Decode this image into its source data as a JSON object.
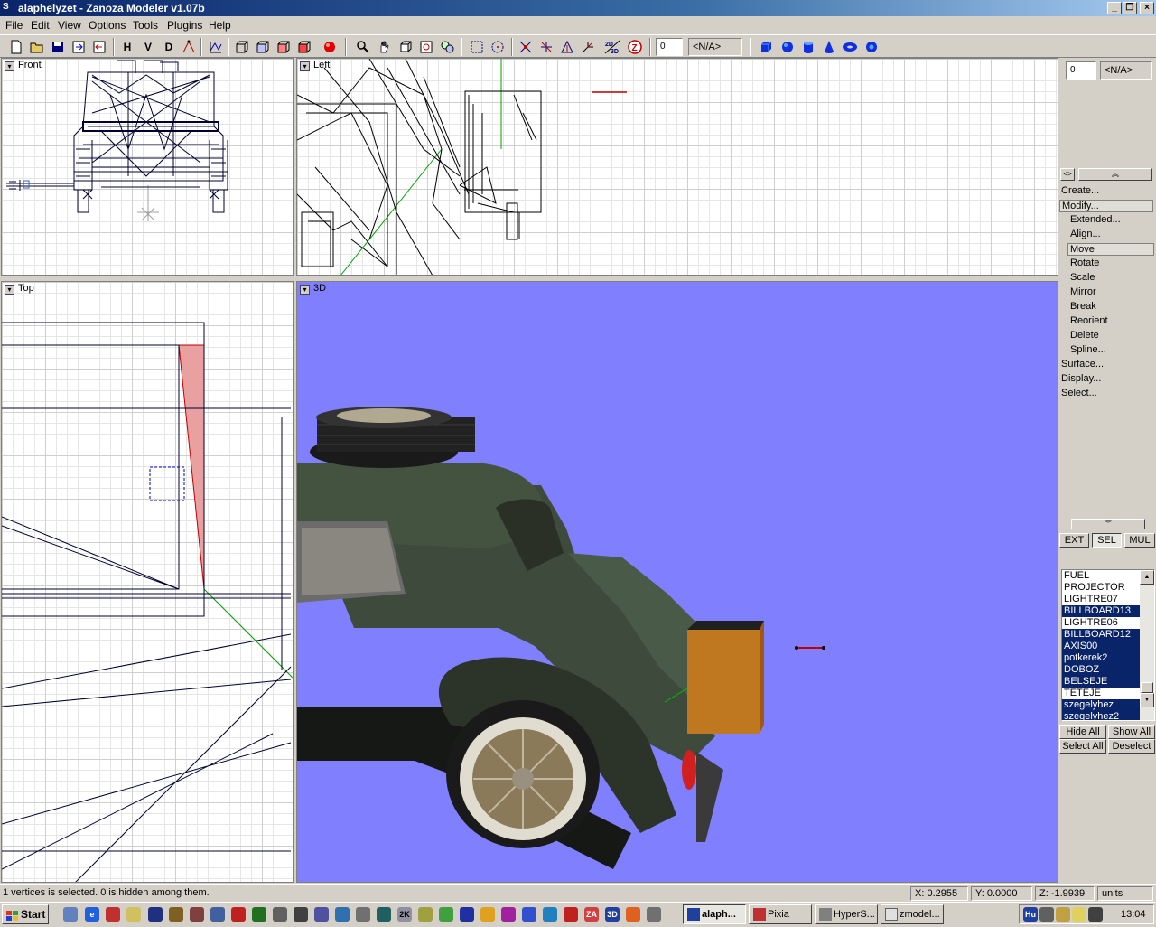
{
  "window": {
    "title": "alaphelyzet - Zanoza Modeler v1.07b"
  },
  "menu": [
    "File",
    "Edit",
    "View",
    "Options",
    "Tools",
    "Plugins",
    "Help"
  ],
  "toolbar": {
    "letters": [
      "H",
      "V",
      "D"
    ],
    "spin_value": "0",
    "na_value": "<N/A>"
  },
  "viewports": {
    "front": "Front",
    "left": "Left",
    "top": "Top",
    "threed": "3D"
  },
  "panel": {
    "spin_value": "0",
    "na_value": "<N/A>",
    "menu": [
      {
        "label": "Create...",
        "sub": false
      },
      {
        "label": "Modify...",
        "sub": false,
        "selected": true
      },
      {
        "label": "Extended...",
        "sub": true
      },
      {
        "label": "Align...",
        "sub": true
      },
      {
        "label": "Move",
        "sub": true,
        "selected": true
      },
      {
        "label": "Rotate",
        "sub": true
      },
      {
        "label": "Scale",
        "sub": true
      },
      {
        "label": "Mirror",
        "sub": true
      },
      {
        "label": "Break",
        "sub": true
      },
      {
        "label": "Reorient",
        "sub": true
      },
      {
        "label": "Delete",
        "sub": true
      },
      {
        "label": "Spline...",
        "sub": true
      },
      {
        "label": "Surface...",
        "sub": false
      },
      {
        "label": "Display...",
        "sub": false
      },
      {
        "label": "Select...",
        "sub": false
      }
    ],
    "mode_buttons": [
      "EXT",
      "SEL",
      "MUL"
    ],
    "objects": [
      {
        "name": "FUEL",
        "selected": false
      },
      {
        "name": "PROJECTOR",
        "selected": false
      },
      {
        "name": "LIGHTRE07",
        "selected": false
      },
      {
        "name": "BILLBOARD13",
        "selected": true
      },
      {
        "name": "LIGHTRE06",
        "selected": false
      },
      {
        "name": "BILLBOARD12",
        "selected": true
      },
      {
        "name": "AXIS00",
        "selected": true
      },
      {
        "name": "potkerek2",
        "selected": true
      },
      {
        "name": "DOBOZ",
        "selected": true
      },
      {
        "name": "BELSEJE",
        "selected": true
      },
      {
        "name": "TETEJE",
        "selected": false
      },
      {
        "name": "szegelyhez",
        "selected": true
      },
      {
        "name": "szegelyhez2",
        "selected": true
      }
    ],
    "actions": [
      "Hide All",
      "Show All",
      "Select All",
      "Deselect"
    ]
  },
  "status": {
    "message": "1 vertices is selected. 0 is hidden among them.",
    "x": "X: 0.2955",
    "y": "Y: 0.0000",
    "z": "Z: -1.9939",
    "units": "units"
  },
  "taskbar": {
    "start": "Start",
    "tasks": [
      "alaph...",
      "Pixia",
      "HyperS...",
      "zmodel..."
    ],
    "tray_lang": "Hu",
    "clock": "13:04"
  },
  "colors": {
    "titlebar": "#0a246a",
    "viewport3d_bg": "#8080ff",
    "selection": "#0a246a",
    "car_body": "#3d4a3c"
  }
}
